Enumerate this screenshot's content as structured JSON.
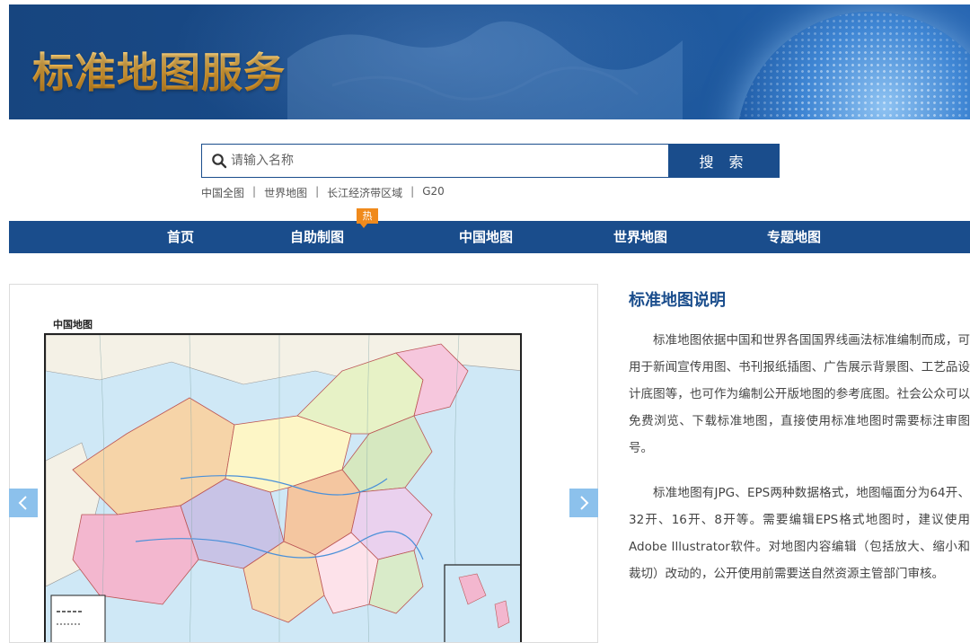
{
  "banner": {
    "title": "标准地图服务"
  },
  "search": {
    "placeholder": "请输入名称",
    "button_label": "搜 索"
  },
  "quick_links": [
    {
      "label": "中国全图"
    },
    {
      "label": "世界地图"
    },
    {
      "label": "长江经济带区域"
    },
    {
      "label": "G20"
    }
  ],
  "nav": {
    "items": [
      {
        "label": "首页"
      },
      {
        "label": "自助制图"
      },
      {
        "label": "中国地图"
      },
      {
        "label": "世界地图"
      },
      {
        "label": "专题地图"
      }
    ],
    "hot_badge": "热"
  },
  "carousel": {
    "map_title": "中国地图",
    "prev_icon": "chevron-left-icon",
    "next_icon": "chevron-right-icon"
  },
  "description": {
    "heading": "标准地图说明",
    "paragraphs": [
      "标准地图依据中国和世界各国国界线画法标准编制而成，可用于新闻宣传用图、书刊报纸插图、广告展示背景图、工艺品设计底图等，也可作为编制公开版地图的参考底图。社会公众可以免费浏览、下载标准地图，直接使用标准地图时需要标注审图号。",
      "标准地图有JPG、EPS两种数据格式，地图幅面分为64开、32开、16开、8开等。需要编辑EPS格式地图时，建议使用Adobe Illustrator软件。对地图内容编辑（包括放大、缩小和裁切）改动的，公开使用前需要送自然资源主管部门审核。"
    ]
  },
  "colors": {
    "brand_blue": "#1a4d8c",
    "hot_orange": "#f08a1c",
    "arrow_blue": "#8cc1ec"
  }
}
